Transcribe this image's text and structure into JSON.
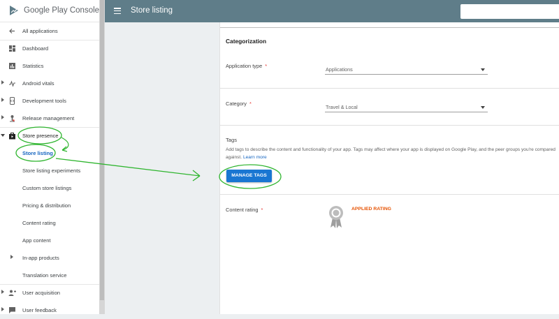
{
  "app": {
    "logo_text": "Google Play Console"
  },
  "header": {
    "title": "Store listing",
    "search_placeholder": ""
  },
  "sidebar": {
    "items": [
      {
        "label": "All applications",
        "icon": "arrow-left-icon"
      },
      {
        "label": "Dashboard",
        "icon": "dashboard-icon"
      },
      {
        "label": "Statistics",
        "icon": "statistics-icon"
      },
      {
        "label": "Android vitals",
        "icon": "vitals-icon"
      },
      {
        "label": "Development tools",
        "icon": "devtools-icon"
      },
      {
        "label": "Release management",
        "icon": "release-icon"
      },
      {
        "label": "Store presence",
        "icon": "store-icon"
      },
      {
        "label": "Store listing"
      },
      {
        "label": "Store listing experiments"
      },
      {
        "label": "Custom store listings"
      },
      {
        "label": "Pricing & distribution"
      },
      {
        "label": "Content rating"
      },
      {
        "label": "App content"
      },
      {
        "label": "In-app products"
      },
      {
        "label": "Translation service"
      },
      {
        "label": "User acquisition",
        "icon": "user-acquisition-icon"
      },
      {
        "label": "User feedback",
        "icon": "feedback-icon"
      }
    ]
  },
  "main": {
    "section_title": "Categorization",
    "application_type": {
      "label": "Application type",
      "required": "*",
      "value": "Applications"
    },
    "category": {
      "label": "Category",
      "required": "*",
      "value": "Travel & Local"
    },
    "tags": {
      "title": "Tags",
      "description": "Add tags to describe the content and functionality of your app. Tags may affect where your app is displayed on Google Play, and the peer groups you're compared against.",
      "learn_more": "Learn more",
      "button": "MANAGE TAGS"
    },
    "content_rating": {
      "label": "Content rating",
      "required": "*",
      "status": "APPLIED RATING"
    }
  },
  "colors": {
    "header_bg": "#5f7d89",
    "primary_button": "#1976d2",
    "link": "#1565c0",
    "required": "#e53935",
    "rating_status": "#e65100",
    "annotation": "#2fb52f"
  }
}
